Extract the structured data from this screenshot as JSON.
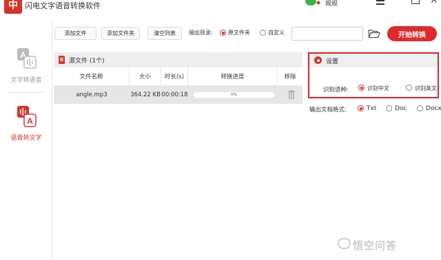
{
  "app": {
    "logo_text": "中",
    "title": "闪电文字语音转换软件",
    "user_name": "规规",
    "close_glyph": "×"
  },
  "sidebar": {
    "items": [
      {
        "label": "文字转语音",
        "icon_letter": "A"
      },
      {
        "label": "语音转文字",
        "icon_letter": "A"
      }
    ]
  },
  "toolbar": {
    "add_file": "添加文件",
    "add_folder": "添加文件夹",
    "clear_list": "清空列表",
    "output_label": "输出目录:",
    "output_options": [
      "原文件夹",
      "自定义"
    ],
    "output_selected": "原文件夹",
    "path_value": "",
    "start_button": "开始转换"
  },
  "file_panel": {
    "title": "源文件 (1个)",
    "columns": [
      "文件名称",
      "大小",
      "时长(s)",
      "转换进度",
      "移除"
    ],
    "rows": [
      {
        "name": "angle.mp3",
        "size": "364.22 KB",
        "duration": "00:00:18",
        "progress_text": "0%",
        "progress": 0
      }
    ]
  },
  "settings": {
    "title": "设置",
    "lang_label": "识别语种:",
    "lang_options": [
      "识别中文",
      "识别英文"
    ],
    "lang_selected": "识别中文"
  },
  "format": {
    "label": "输出文档格式:",
    "options": [
      "Txt",
      "Doc",
      "Docx"
    ],
    "selected": "Txt"
  },
  "watermark": {
    "text": "悟空问答"
  },
  "colors": {
    "accent": "#d8322a",
    "start_button": "#e0292a",
    "highlight_border": "#e61e1e"
  }
}
